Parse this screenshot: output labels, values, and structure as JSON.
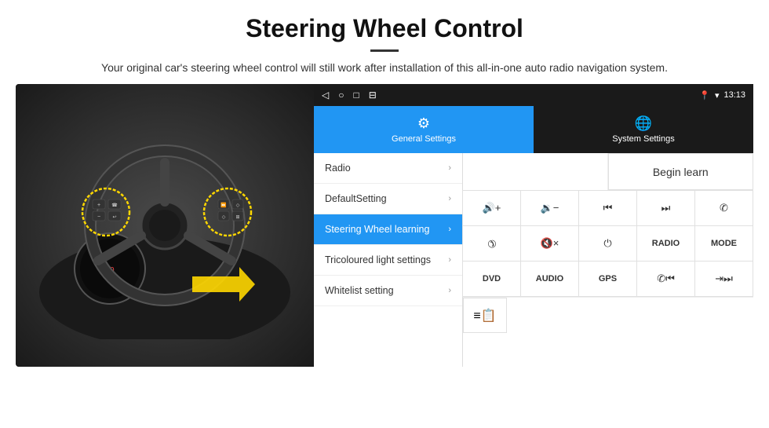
{
  "header": {
    "title": "Steering Wheel Control",
    "subtitle": "Your original car's steering wheel control will still work after installation of this all-in-one auto radio navigation system."
  },
  "status_bar": {
    "time": "13:13",
    "icons": [
      "◁",
      "○",
      "□",
      "⊟"
    ]
  },
  "tabs": [
    {
      "id": "general",
      "label": "General Settings",
      "active": true
    },
    {
      "id": "system",
      "label": "System Settings",
      "active": false
    }
  ],
  "menu": {
    "items": [
      {
        "id": "radio",
        "label": "Radio",
        "active": false
      },
      {
        "id": "default",
        "label": "DefaultSetting",
        "active": false
      },
      {
        "id": "steering",
        "label": "Steering Wheel learning",
        "active": true
      },
      {
        "id": "tricoloured",
        "label": "Tricoloured light settings",
        "active": false
      },
      {
        "id": "whitelist",
        "label": "Whitelist setting",
        "active": false
      }
    ]
  },
  "controls": {
    "begin_learn_label": "Begin learn",
    "buttons_row1": [
      {
        "id": "vol-up",
        "label": "🔊+",
        "type": "icon"
      },
      {
        "id": "vol-down",
        "label": "🔉-",
        "type": "icon"
      },
      {
        "id": "prev",
        "label": "⏮",
        "type": "icon"
      },
      {
        "id": "next",
        "label": "⏭",
        "type": "icon"
      },
      {
        "id": "phone",
        "label": "✆",
        "type": "icon"
      }
    ],
    "buttons_row2": [
      {
        "id": "phone-hang",
        "label": "↩",
        "type": "icon"
      },
      {
        "id": "mute",
        "label": "🔇×",
        "type": "icon"
      },
      {
        "id": "power",
        "label": "⏻",
        "type": "icon"
      },
      {
        "id": "radio",
        "label": "RADIO",
        "type": "text"
      },
      {
        "id": "mode",
        "label": "MODE",
        "type": "text"
      }
    ],
    "buttons_row3": [
      {
        "id": "dvd",
        "label": "DVD",
        "type": "text"
      },
      {
        "id": "audio",
        "label": "AUDIO",
        "type": "text"
      },
      {
        "id": "gps",
        "label": "GPS",
        "type": "text"
      },
      {
        "id": "phone-prev",
        "label": "✆⏮",
        "type": "icon"
      },
      {
        "id": "phone-next",
        "label": "⇥⏭",
        "type": "icon"
      }
    ],
    "whitelist_icon": "≡📋"
  }
}
